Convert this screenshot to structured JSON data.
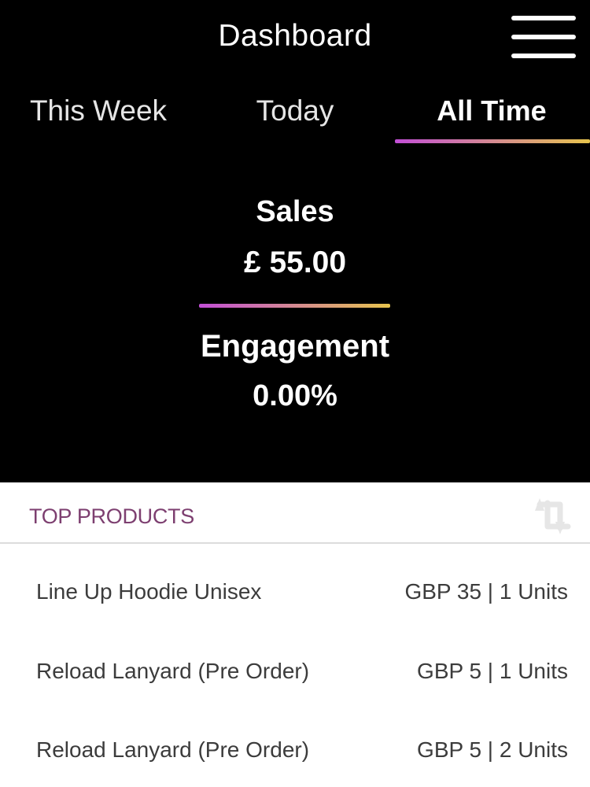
{
  "header": {
    "title": "Dashboard"
  },
  "tabs": [
    {
      "label": "This Week"
    },
    {
      "label": "Today"
    },
    {
      "label": "All Time",
      "active": true
    }
  ],
  "stats": {
    "sales_label": "Sales",
    "sales_value": "£ 55.00",
    "engagement_label": "Engagement",
    "engagement_value": "0.00%"
  },
  "top_products": {
    "title": "TOP PRODUCTS",
    "items": [
      {
        "name": "Line Up Hoodie Unisex",
        "meta": "GBP 35 | 1 Units"
      },
      {
        "name": "Reload Lanyard (Pre Order)",
        "meta": "GBP 5 | 1 Units"
      },
      {
        "name": "Reload Lanyard (Pre Order)",
        "meta": "GBP 5 | 2 Units"
      }
    ]
  },
  "icons": {
    "menu": "hamburger-menu-icon",
    "refresh": "refresh-icon"
  },
  "colors": {
    "background": "#000000",
    "accent_gradient_start": "#c24fd6",
    "accent_gradient_end": "#e7c44d",
    "section_title": "#7d3f70"
  }
}
